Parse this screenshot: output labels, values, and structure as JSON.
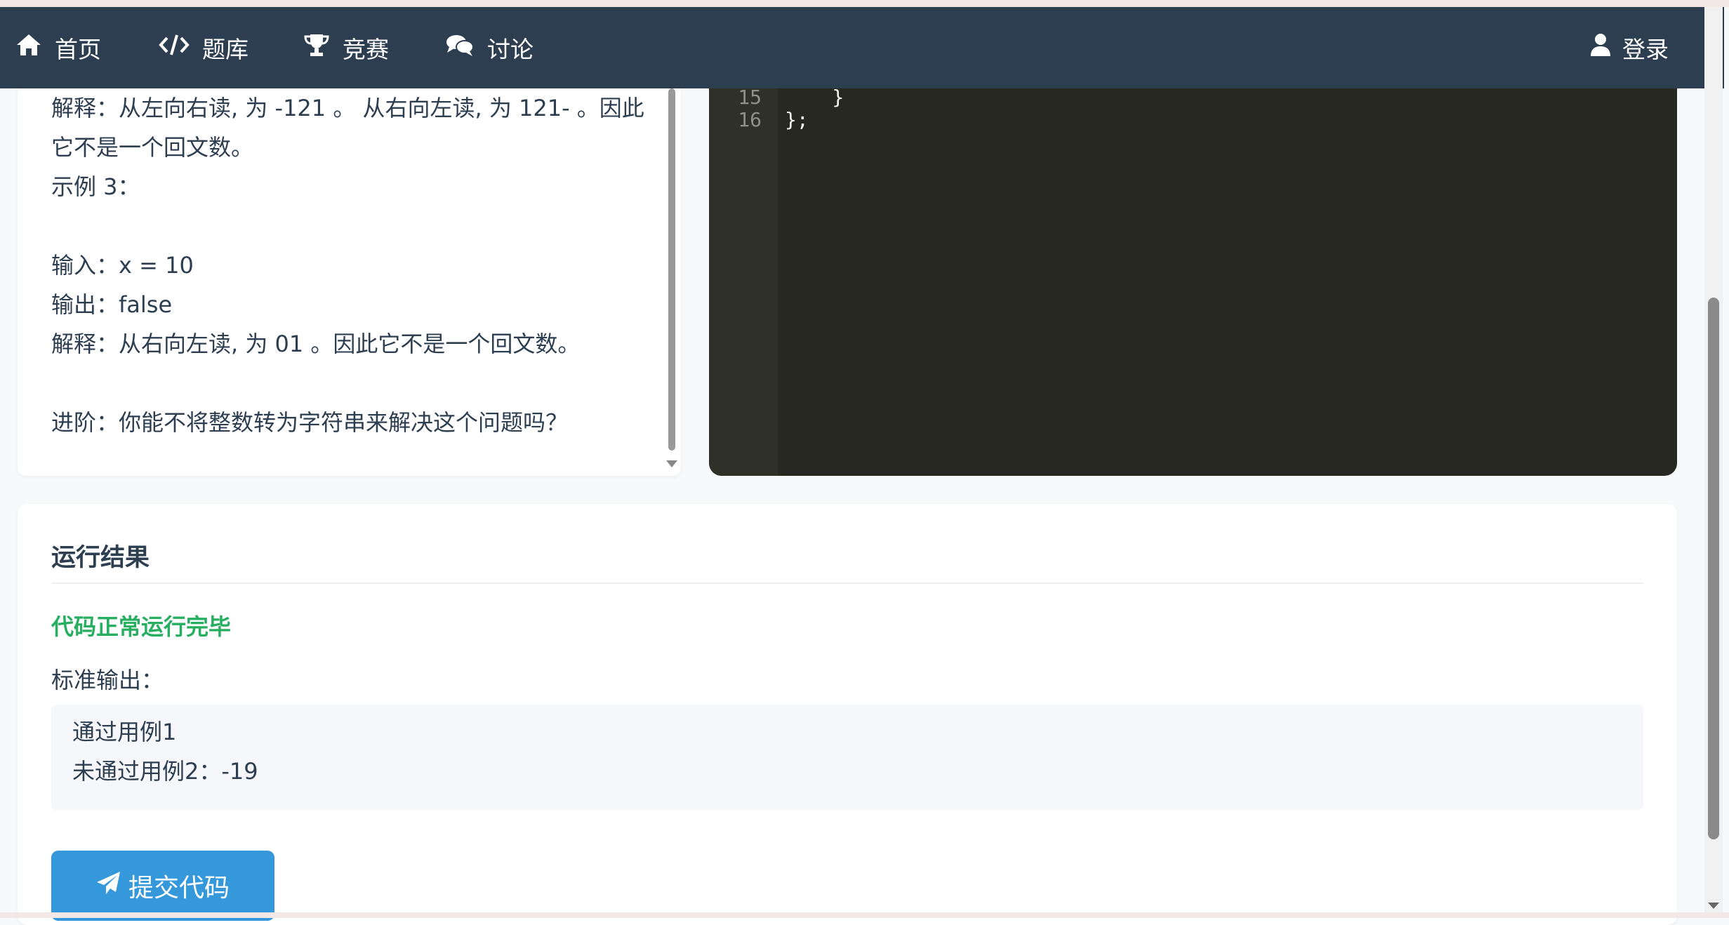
{
  "nav": {
    "items": [
      {
        "label": "首页",
        "icon": "home-icon"
      },
      {
        "label": "题库",
        "icon": "code-icon"
      },
      {
        "label": "竞赛",
        "icon": "trophy-icon"
      },
      {
        "label": "讨论",
        "icon": "comments-icon"
      }
    ],
    "login_label": "登录"
  },
  "problem": {
    "lines": [
      "解释：从左向右读, 为 -121 。 从右向左读, 为 121- 。因此",
      "它不是一个回文数。",
      "示例 3：",
      "",
      "输入：x = 10",
      "输出：false",
      "解释：从右向左读, 为 01 。因此它不是一个回文数。",
      "",
      "进阶：你能不将整数转为字符串来解决这个问题吗？"
    ]
  },
  "editor": {
    "lines": [
      {
        "num": "15",
        "code": "    }"
      },
      {
        "num": "16",
        "code": "};"
      }
    ]
  },
  "result": {
    "title": "运行结果",
    "status": "代码正常运行完毕",
    "stdout_label": "标准输出：",
    "stdout_lines": [
      "通过用例1",
      "未通过用例2：-19"
    ],
    "submit_label": "提交代码"
  },
  "colors": {
    "navbar": "#2c3e50",
    "editor_bg": "#272822",
    "success": "#27ae60",
    "primary": "#3498db"
  }
}
